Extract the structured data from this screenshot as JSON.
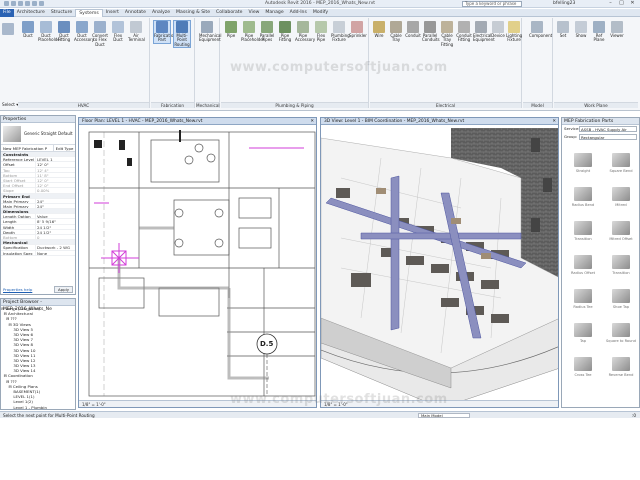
{
  "app": {
    "title": "Autodesk Revit 2016 - MEP_2016_Whats_New.rvt",
    "search_placeholder": "Type a keyword or phrase",
    "user": "bfelling23",
    "watermark": "www.computersoftjuan.com"
  },
  "window_controls": [
    "–",
    "□",
    "✕"
  ],
  "ribbon_tabs": [
    "File",
    "Architecture",
    "Structure",
    "Systems",
    "Insert",
    "Annotate",
    "Analyze",
    "Massing & Site",
    "Collaborate",
    "View",
    "Manage",
    "Add-Ins",
    "Modify"
  ],
  "active_tab": "Systems",
  "ribbon_groups": [
    {
      "label": "HVAC",
      "buttons": [
        "Duct",
        "Duct Placeholder",
        "Duct Fitting",
        "Duct Accessory",
        "Convert to Flex Duct",
        "Flex Duct",
        "Air Terminal"
      ]
    },
    {
      "label": "Fabrication",
      "buttons": [
        "Fabrication Part",
        "Multi-Point Routing"
      ]
    },
    {
      "label": "Mechanical",
      "buttons": [
        "Mechanical Equipment"
      ]
    },
    {
      "label": "Plumbing & Piping",
      "buttons": [
        "Pipe",
        "Pipe Placeholder",
        "Parallel Pipes",
        "Pipe Fitting",
        "Pipe Accessory",
        "Flex Pipe",
        "Plumbing Fixture",
        "Sprinkler"
      ]
    },
    {
      "label": "Electrical",
      "buttons": [
        "Wire",
        "Cable Tray",
        "Conduit",
        "Parallel Conduits",
        "Cable Tray Fitting",
        "Conduit Fitting",
        "Electrical Equipment",
        "Device",
        "Lighting Fixture"
      ]
    },
    {
      "label": "Model",
      "buttons": [
        "Component"
      ]
    },
    {
      "label": "Work Plane",
      "buttons": [
        "Set",
        "Show",
        "Ref Plane",
        "Viewer"
      ]
    }
  ],
  "select_label": "Select ▾",
  "properties": {
    "title": "Properties",
    "type_name": "Generic Straight Default",
    "type_selector": "New MEP Fabrication P",
    "edit_type": "Edit Type",
    "sections": [
      {
        "name": "Constraints",
        "rows": [
          [
            "Reference Level",
            "LEVEL 1"
          ],
          [
            "Offset",
            "12' 0\""
          ],
          [
            "Top",
            "12' 4\""
          ],
          [
            "Bottom",
            "11' 8\""
          ],
          [
            "Start Offset",
            "12' 0\""
          ],
          [
            "End Offset",
            "12' 0\""
          ],
          [
            "Slope",
            "0.00%"
          ]
        ]
      },
      {
        "name": "Primary End",
        "rows": [
          [
            "Main Primary",
            "24\""
          ],
          [
            "Main Primary",
            "24\""
          ]
        ]
      },
      {
        "name": "Dimensions",
        "rows": [
          [
            "Length Option",
            "Value"
          ],
          [
            "Length",
            "8' 5 9/16\""
          ],
          [
            "Width",
            "24 1/2\""
          ],
          [
            "Depth",
            "24 1/2\""
          ],
          [
            "Bottom",
            "0"
          ]
        ]
      },
      {
        "name": "Mechanical",
        "rows": [
          [
            "Specification",
            "Ductwork - 2 WG"
          ],
          [
            "Insulation Spec",
            "None"
          ]
        ]
      }
    ],
    "help_link": "Properties help",
    "apply": "Apply"
  },
  "project_browser": {
    "title": "Project Browser - MEP_2016_Whats_Ne",
    "nodes": [
      "⊟ Views (Discipline)",
      "  ⊟ Architectural",
      "    ⊟ ???",
      "      ⊟ 3D Views",
      "          3D View 5",
      "          3D View 6",
      "          3D View 7",
      "          3D View 8",
      "          3D View 10",
      "          3D View 11",
      "          3D View 12",
      "          3D View 13",
      "          3D View 14",
      "  ⊟ Coordination",
      "    ⊟ ???",
      "      ⊟ Ceiling Plans",
      "          BASEMENT(1)",
      "          LEVEL 1(1)",
      "          Level 1(2)",
      "          Level 1 - Plumbin",
      "          ROOF (24)"
    ]
  },
  "floor_view": {
    "title": "Floor Plan: LEVEL 1 - HVAC - MEP_2016_Whats_New.rvt",
    "scale": "1/8\" = 1'-0\"",
    "grid_label": "D.5"
  },
  "view_3d": {
    "title": "3D View: Level 1 - BIM Coordination - MEP_2016_Whats_New.rvt",
    "scale": "1/8\" = 1'-0\""
  },
  "fab_parts": {
    "title": "MEP Fabrication Parts",
    "service_label": "Service:",
    "service_value": "ASSB - HVAC Supply Air",
    "group_label": "Group:",
    "group_value": "Rectangular",
    "items": [
      "Straight",
      "Square Bend",
      "Radius Bend",
      "Mitred",
      "Transition",
      "Mitred Offset",
      "Radius Offset",
      "Transition",
      "Radius Tee",
      "Shoe Tap",
      "Tap",
      "Square to Round",
      "Cross Tee",
      "Reverse Bend"
    ]
  },
  "status": {
    "hint": "Select the next point for Multi-Point Routing",
    "main_model": "Main Model",
    "coords": ":0"
  }
}
